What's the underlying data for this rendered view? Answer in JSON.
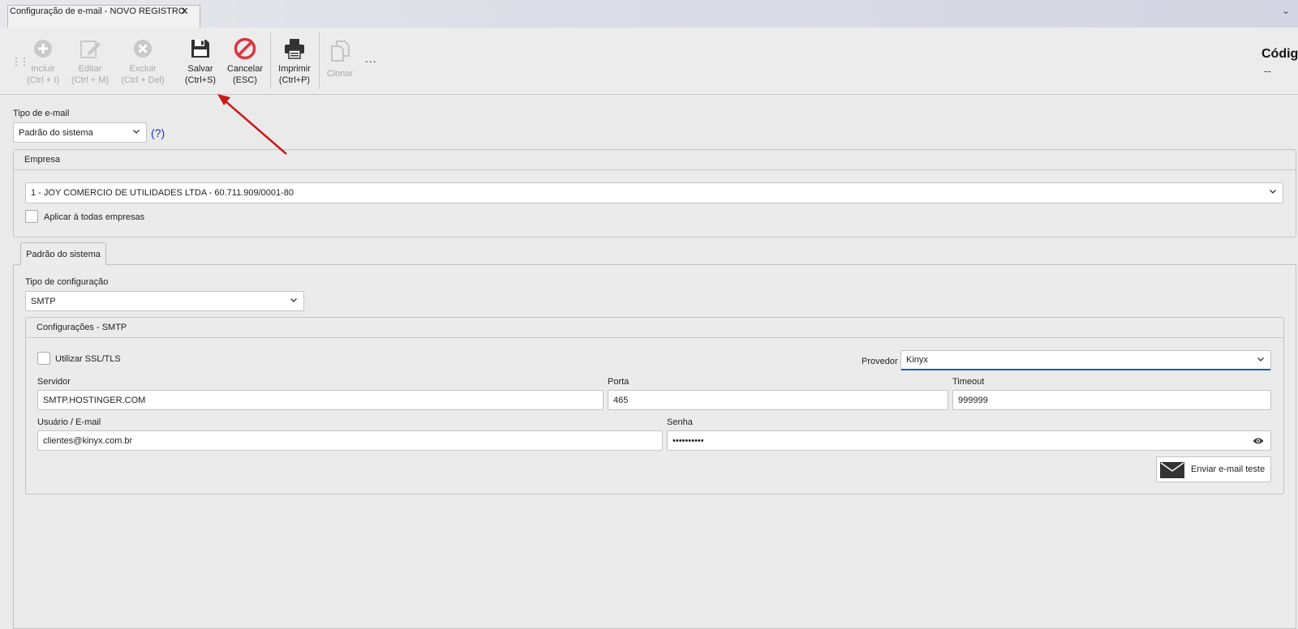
{
  "window": {
    "tab_title": "Configuração de e-mail - NOVO REGISTRO",
    "close_glyph": "✕",
    "strip_menu_glyph": "⌄"
  },
  "toolbar": {
    "grip": "⋮⋮",
    "buttons": [
      {
        "label": "Incluir",
        "shortcut": "(Ctrl + I)",
        "icon": "plus-circle-icon",
        "enabled": false
      },
      {
        "label": "Editar",
        "shortcut": "(Ctrl + M)",
        "icon": "edit-icon",
        "enabled": false
      },
      {
        "label": "Excluir",
        "shortcut": "(Ctrl + Del)",
        "icon": "x-circle-icon",
        "enabled": false
      },
      {
        "label": "Salvar",
        "shortcut": "(Ctrl+S)",
        "icon": "floppy-disk-icon",
        "enabled": true
      },
      {
        "label": "Cancelar",
        "shortcut": "(ESC)",
        "icon": "cancel-icon",
        "enabled": true
      },
      {
        "label": "Imprimir",
        "shortcut": "(Ctrl+P)",
        "icon": "printer-icon",
        "enabled": true
      },
      {
        "label": "Clonar",
        "shortcut": "",
        "icon": "copy-icon",
        "enabled": false
      }
    ],
    "more": "...",
    "codigo_label": "Códig",
    "codigo_value": "--"
  },
  "form": {
    "tipo_email_label": "Tipo de e-mail",
    "tipo_email_value": "Padrão do sistema",
    "help": "(?)",
    "empresa_group": "Empresa",
    "empresa_value": "1 - JOY COMERCIO DE UTILIDADES LTDA - 60.711.909/0001-80",
    "aplicar_label": "Aplicar à todas empresas",
    "tab_label": "Padrão do sistema",
    "tipo_config_label": "Tipo de configuração",
    "tipo_config_value": "SMTP",
    "smtp_group": "Configurações - SMTP",
    "ssl_label": "Utilizar SSL/TLS",
    "provedor_label": "Provedor",
    "provedor_value": "Kinyx",
    "servidor_label": "Servidor",
    "servidor_value": "SMTP.HOSTINGER.COM",
    "porta_label": "Porta",
    "porta_value": "465",
    "timeout_label": "Timeout",
    "timeout_value": "999999",
    "usuario_label": "Usuário / E-mail",
    "usuario_value": "clientes@kinyx.com.br",
    "senha_label": "Senha",
    "senha_value": "••••••••••",
    "send_button": "Enviar e-mail teste"
  },
  "colors": {
    "accent": "#1a5fb4",
    "cancel": "#d9363e",
    "annotation_arrow": "#c81a1a",
    "help_link": "#2030c8"
  }
}
